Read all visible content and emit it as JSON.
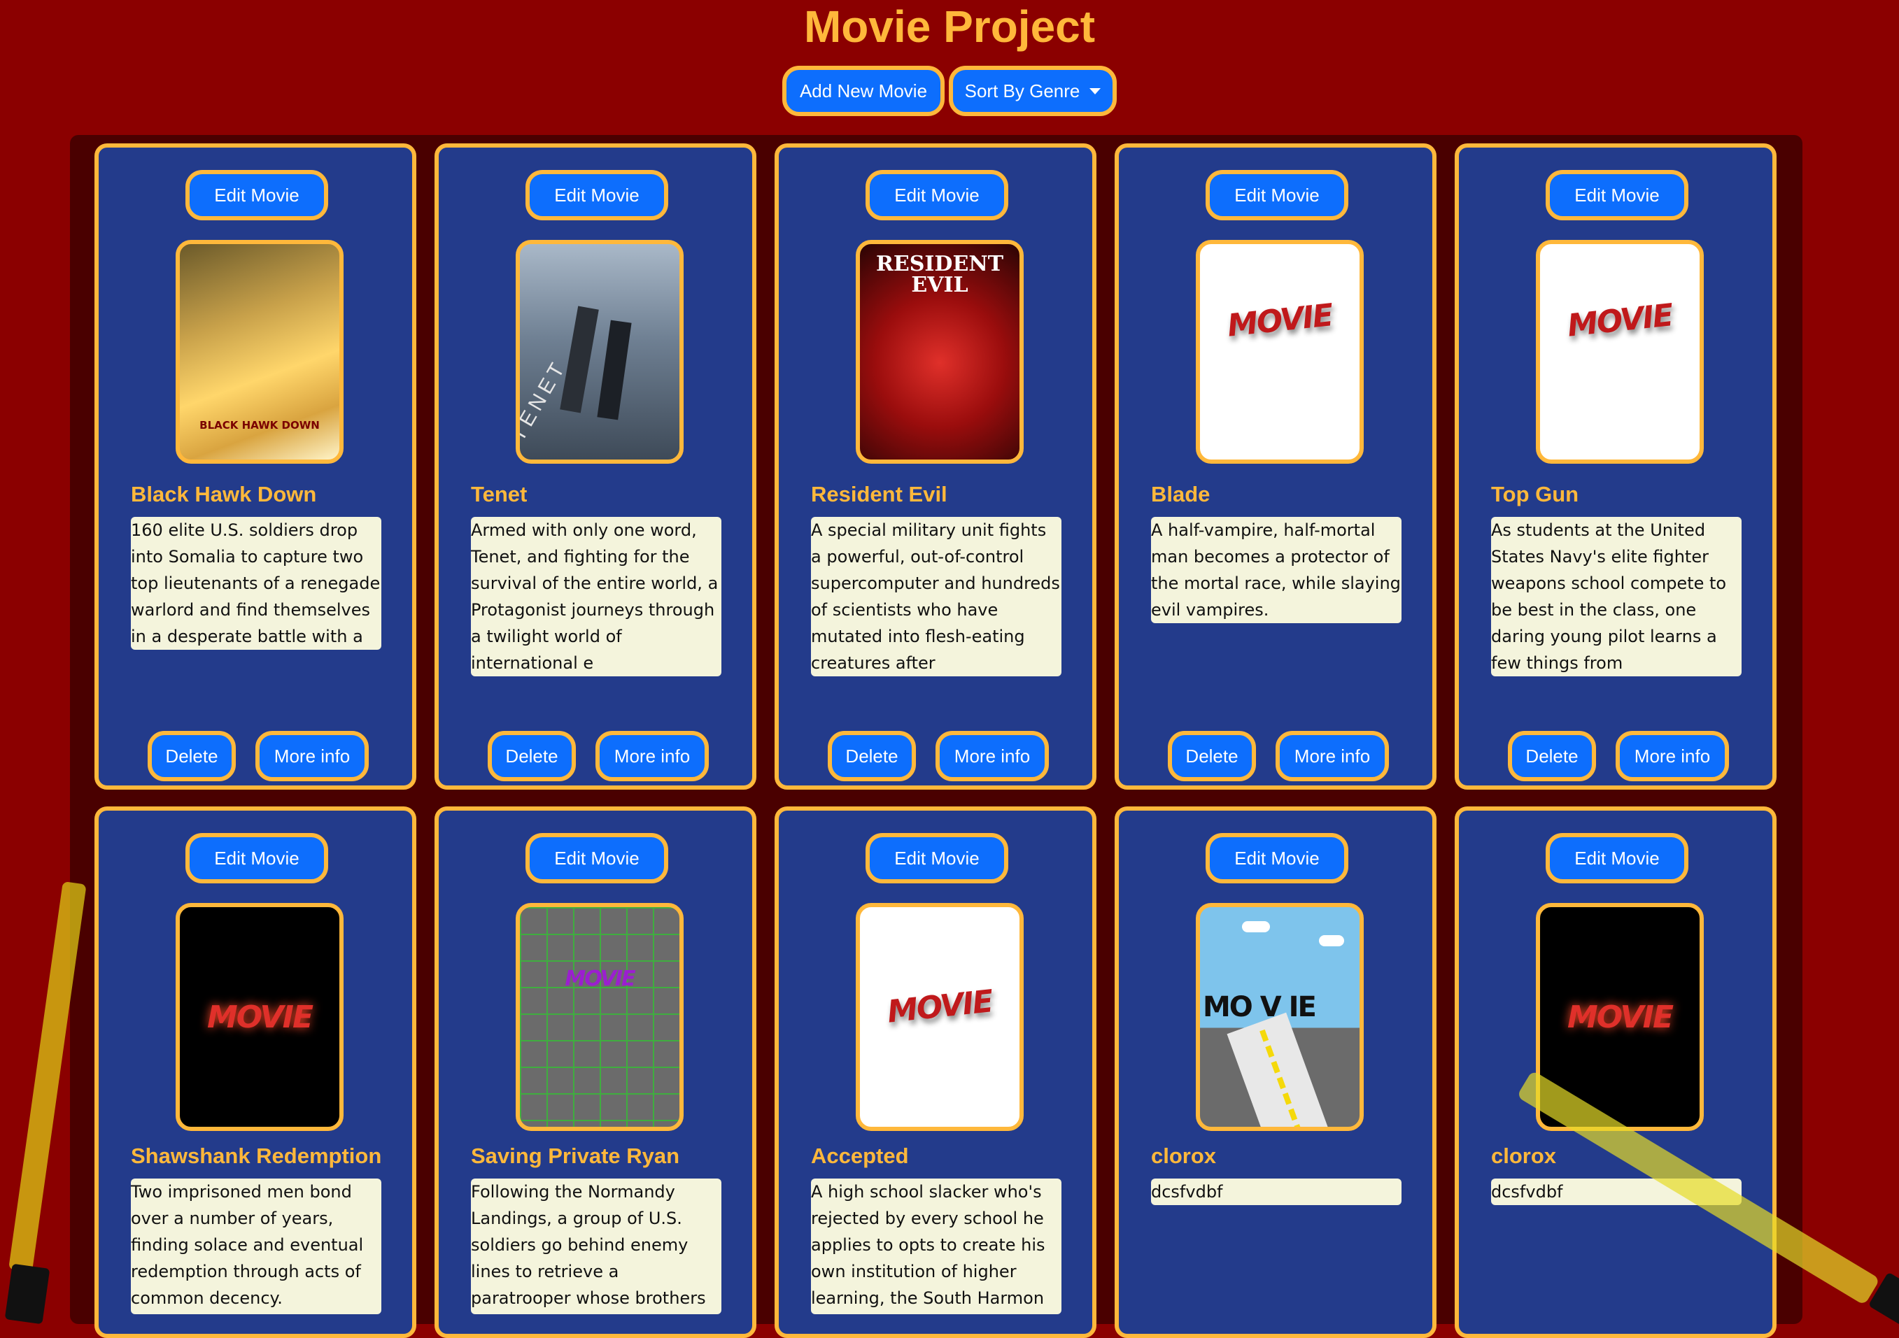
{
  "header": {
    "title": "Movie Project"
  },
  "toolbar": {
    "add_label": "Add New Movie",
    "sort_label": "Sort By Genre"
  },
  "card_actions": {
    "edit_label": "Edit Movie",
    "delete_label": "Delete",
    "more_label": "More info"
  },
  "movies": [
    {
      "title": "Black Hawk Down",
      "description": "160 elite U.S. soldiers drop into Somalia to capture two top lieutenants of a renegade warlord and find themselves in a desperate battle with a large",
      "poster": "Black Hawk Down poster",
      "poster_caption": "BLACK HAWK DOWN"
    },
    {
      "title": "Tenet",
      "description": "Armed with only one word, Tenet, and fighting for the survival of the entire world, a Protagonist journeys through a twilight world of international e",
      "poster": "Tenet poster",
      "poster_caption": "TENET"
    },
    {
      "title": "Resident Evil",
      "description": "A special military unit fights a powerful, out-of-control supercomputer and hundreds of scientists who have mutated into flesh-eating creatures after",
      "poster": "Resident Evil poster",
      "poster_caption": "RESIDENT EVIL"
    },
    {
      "title": "Blade",
      "description": "A half-vampire, half-mortal man becomes a protector of the mortal race, while slaying evil vampires.",
      "poster": "movie placeholder white",
      "poster_caption": "MOVIE"
    },
    {
      "title": "Top Gun",
      "description": "As students at the United States Navy's elite fighter weapons school compete to be best in the class, one daring young pilot learns a few things from",
      "poster": "movie placeholder white",
      "poster_caption": "MOVIE"
    },
    {
      "title": "Shawshank Redemption",
      "description": "Two imprisoned men bond over a number of years, finding solace and eventual redemption through acts of common decency.",
      "poster": "movie placeholder black",
      "poster_caption": "MOVIE"
    },
    {
      "title": "Saving Private Ryan",
      "description": "Following the Normandy Landings, a group of U.S. soldiers go behind enemy lines to retrieve a paratrooper whose brothers have been",
      "poster": "movie placeholder grid",
      "poster_caption": "MOVIE"
    },
    {
      "title": "Accepted",
      "description": "A high school slacker who's rejected by every school he applies to opts to create his own institution of higher learning, the South Harmon",
      "poster": "movie placeholder white",
      "poster_caption": "MOVIE"
    },
    {
      "title": "clorox",
      "description": "dcsfvdbf",
      "poster": "movie placeholder road",
      "poster_caption": "MO V IE"
    },
    {
      "title": "clorox",
      "description": "dcsfvdbf",
      "poster": "movie placeholder black",
      "poster_caption": "MOVIE"
    }
  ],
  "colors": {
    "background": "#8b0000",
    "card": "#233b8b",
    "accent": "#ffb83b",
    "button": "#0d6efd"
  }
}
